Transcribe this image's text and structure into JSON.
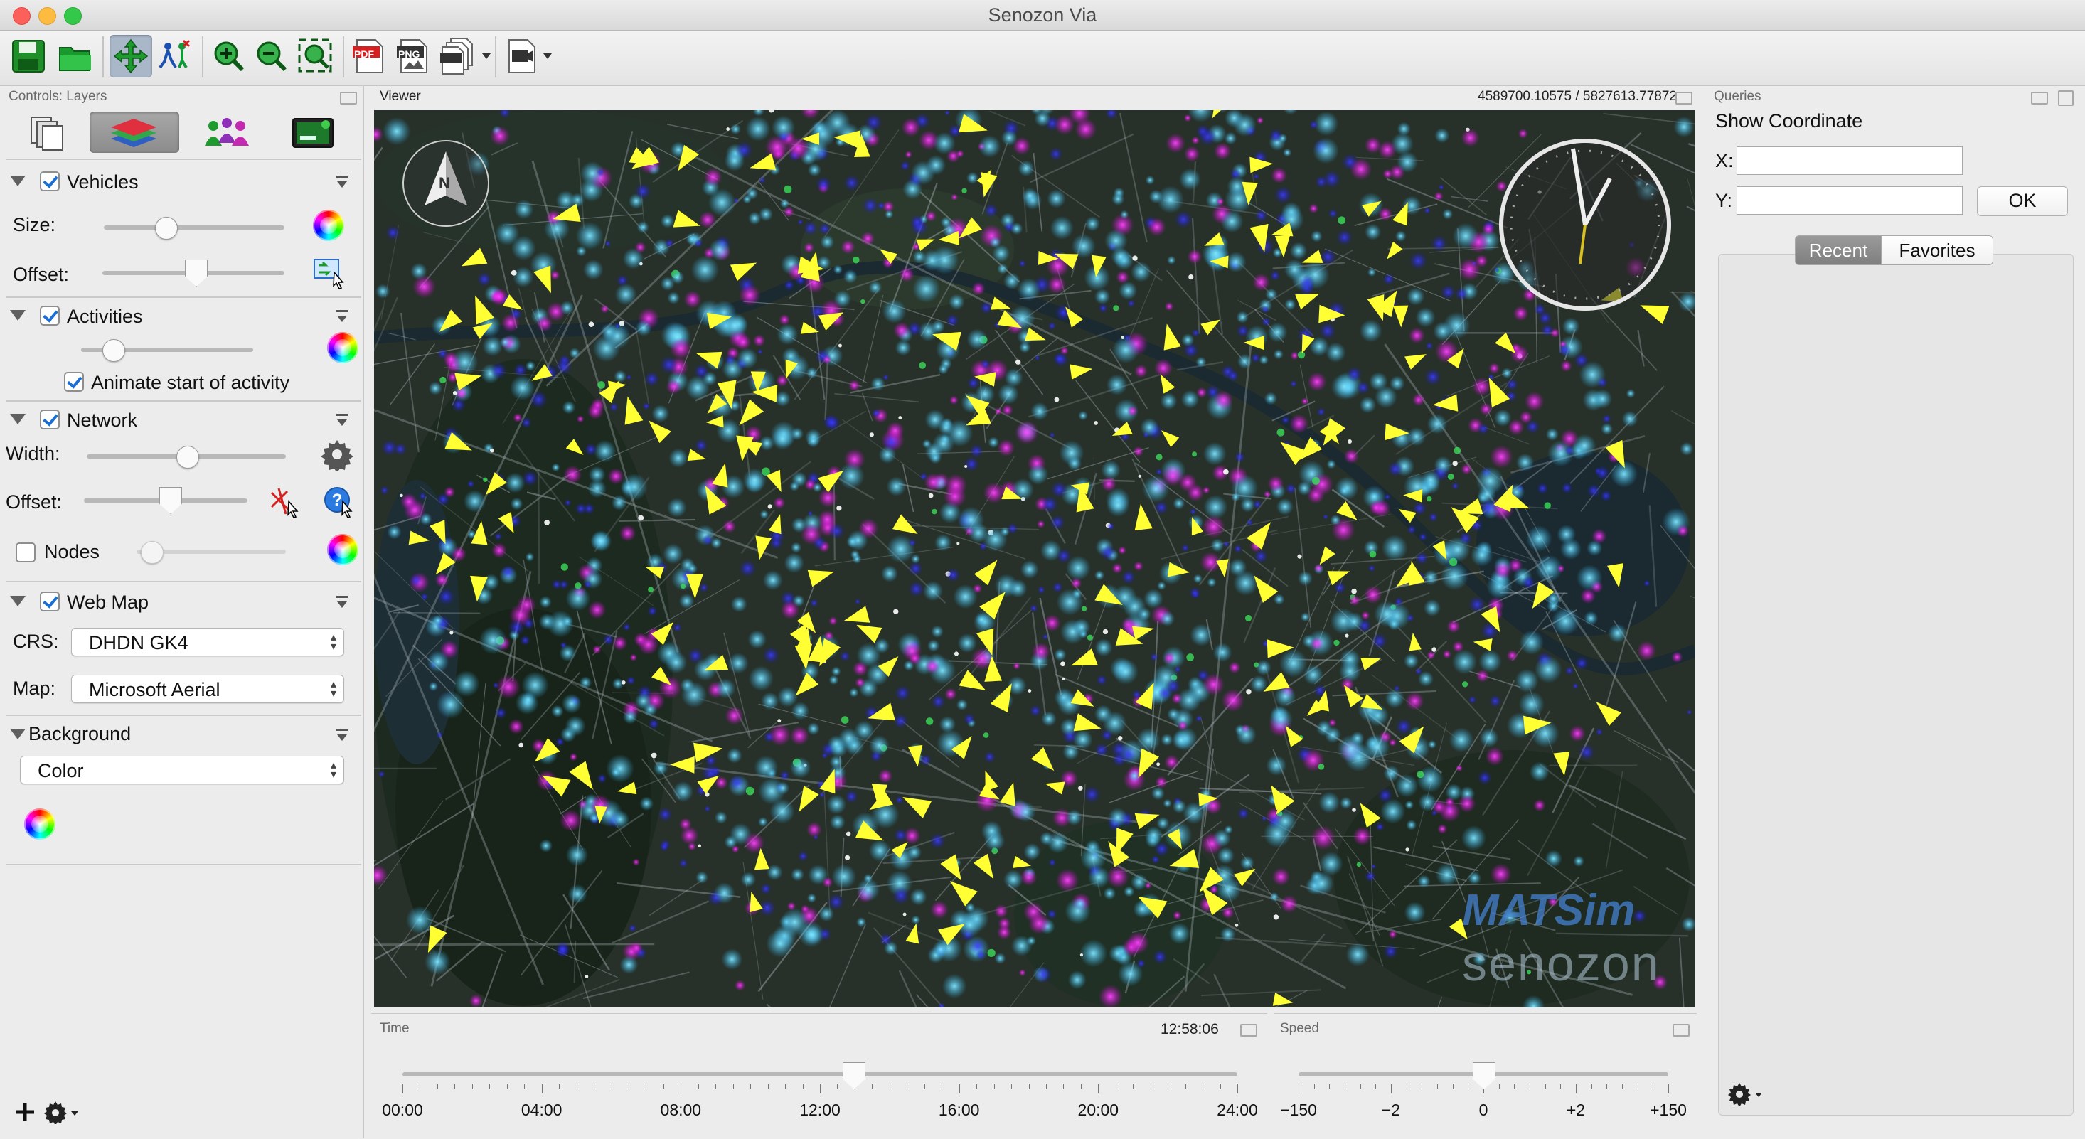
{
  "window": {
    "title": "Senozon Via"
  },
  "toolbar": {
    "buttons": [
      "save-icon",
      "open-folder-icon",
      "pan-icon",
      "select-agents-icon",
      "zoom-in-icon",
      "zoom-out-icon",
      "zoom-extent-icon",
      "export-pdf-icon",
      "export-png-icon",
      "export-png-series-icon",
      "export-movie-icon"
    ],
    "pdf_label": "PDF",
    "png_label": "PNG"
  },
  "left_panel": {
    "header": "Controls: Layers",
    "vehicles": {
      "label": "Vehicles",
      "checked": true,
      "size_label": "Size:",
      "offset_label": "Offset:"
    },
    "activities": {
      "label": "Activities",
      "checked": true,
      "animate_label": "Animate start of activity",
      "animate_checked": true
    },
    "network": {
      "label": "Network",
      "checked": true,
      "width_label": "Width:",
      "offset_label": "Offset:",
      "nodes_label": "Nodes",
      "nodes_checked": false
    },
    "webmap": {
      "label": "Web Map",
      "checked": true,
      "crs_label": "CRS:",
      "crs_value": "DHDN GK4",
      "map_label": "Map:",
      "map_value": "Microsoft Aerial"
    },
    "background": {
      "label": "Background",
      "value": "Color"
    }
  },
  "viewer": {
    "header": "Viewer",
    "coords": "4589700.10575 / 5827613.77872",
    "compass_letter": "N",
    "logo1": "MATSim",
    "logo2": "senozon"
  },
  "time": {
    "header": "Time",
    "value": "12:58:06",
    "position_fraction": 0.54,
    "ticks": [
      "00:00",
      "04:00",
      "08:00",
      "12:00",
      "16:00",
      "20:00",
      "24:00"
    ]
  },
  "speed": {
    "header": "Speed",
    "position_fraction": 0.5,
    "ticks": [
      "−150",
      "−2",
      "0",
      "+2",
      "+150"
    ]
  },
  "queries": {
    "header": "Queries",
    "title": "Show Coordinate",
    "x_label": "X:",
    "y_label": "Y:",
    "ok_label": "OK",
    "tab_recent": "Recent",
    "tab_favorites": "Favorites"
  },
  "colors": {
    "accent": "#1a6fd6",
    "agent": "#ffff33",
    "map_bg": "#273129"
  }
}
